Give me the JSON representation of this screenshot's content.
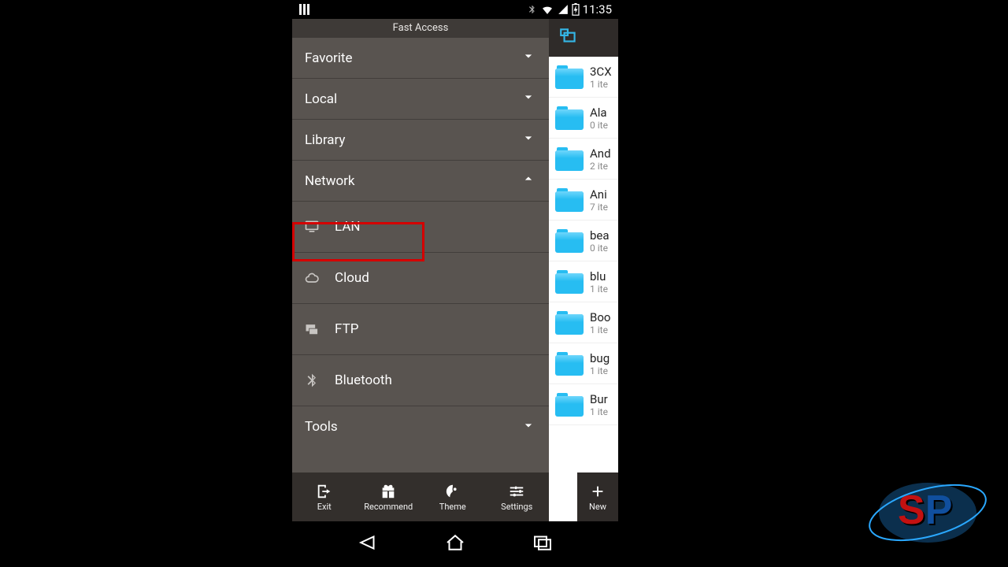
{
  "status": {
    "time": "11:35"
  },
  "drawer": {
    "title": "Fast Access",
    "sections": {
      "favorite": "Favorite",
      "local": "Local",
      "library": "Library",
      "network": "Network",
      "tools": "Tools"
    },
    "network_items": {
      "lan": "LAN",
      "cloud": "Cloud",
      "ftp": "FTP",
      "bluetooth": "Bluetooth"
    },
    "bottom": {
      "exit": "Exit",
      "recommend": "Recommend",
      "theme": "Theme",
      "settings": "Settings"
    }
  },
  "files": [
    {
      "name": "3CX",
      "meta": "1 ite"
    },
    {
      "name": "Ala",
      "meta": "0 ite"
    },
    {
      "name": "And",
      "meta": "2 ite"
    },
    {
      "name": "Ani",
      "meta": "7 ite"
    },
    {
      "name": "bea",
      "meta": "0 ite"
    },
    {
      "name": "blu",
      "meta": "1 ite"
    },
    {
      "name": "Boo",
      "meta": "1 ite"
    },
    {
      "name": "bug",
      "meta": "1 ite"
    },
    {
      "name": "Bur",
      "meta": "1 ite"
    }
  ],
  "newbtn": "New"
}
